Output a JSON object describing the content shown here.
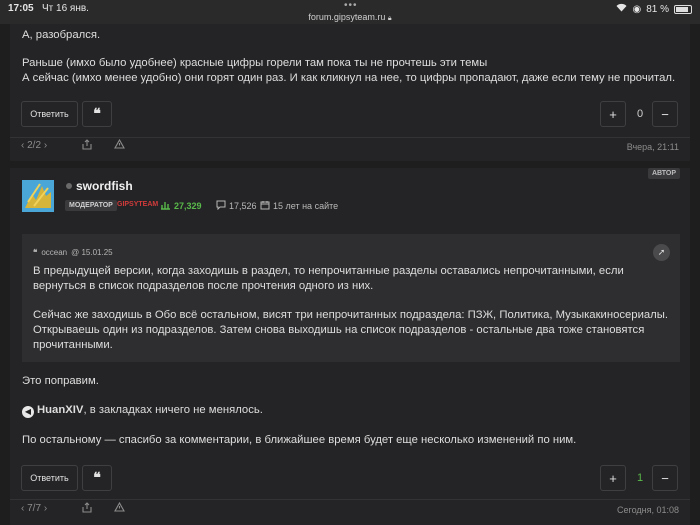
{
  "status_bar": {
    "time": "17:05",
    "date": "Чт 16 янв.",
    "url": "forum.gipsyteam.ru",
    "battery": "81 %"
  },
  "post1": {
    "line1": "А, разобрался.",
    "line2": "Раньше (имхо было удобнее) красные цифры горели  там пока ты не прочтешь эти темы",
    "line3": "А сейчас (имхо менее удобно) они горят один раз. И как кликнул на нее, то цифры пропадают, даже если тему не прочитал.",
    "reply_label": "Ответить",
    "quote_label": "❝",
    "vote_count": "0",
    "page_indicator": "2/2",
    "timestamp": "Вчера, 21:11"
  },
  "post2": {
    "author_badge": "АВТОР",
    "username": "swordfish",
    "role": "МОДЕРАТОР",
    "role_label": "GIPSYTEAM",
    "stat_rating": "27,329",
    "stat_messages": "17,526",
    "stat_membership": "15 лет на сайте",
    "quote": {
      "author": "occean",
      "date": "@ 15.01.25",
      "line1": "В предыдущей версии, когда заходишь в раздел, то непрочитанные разделы оставались непрочитанными, если",
      "line2": "вернуться в список подразделов после прочтения одного из них.",
      "line3": "Сейчас же заходишь в Обо всё остальном, висят три непрочитанных подраздела: ПЗЖ, Политика, Музыкакиносериалы.",
      "line4": "Открываешь один из подразделов. Затем снова выходишь на список подразделов - остальные два тоже становятся",
      "line5": "прочитанными."
    },
    "text1": "Это поправим.",
    "mention_name": "HuanXIV",
    "mention_rest": ", в закладках ничего не менялось.",
    "text3": "По остальному — спасибо за комментарии, в ближайшее время будет еще несколько изменений по ним.",
    "reply_label": "Ответить",
    "quote_label": "❝",
    "vote_count": "1",
    "page_indicator": "7/7",
    "timestamp": "Сегодня, 01:08"
  },
  "colors": {
    "background": "#1e1e1f",
    "post_bg": "#242426",
    "quote_bg": "#2e2e30",
    "accent_green": "#59b94a",
    "accent_red": "#d23b3b"
  }
}
